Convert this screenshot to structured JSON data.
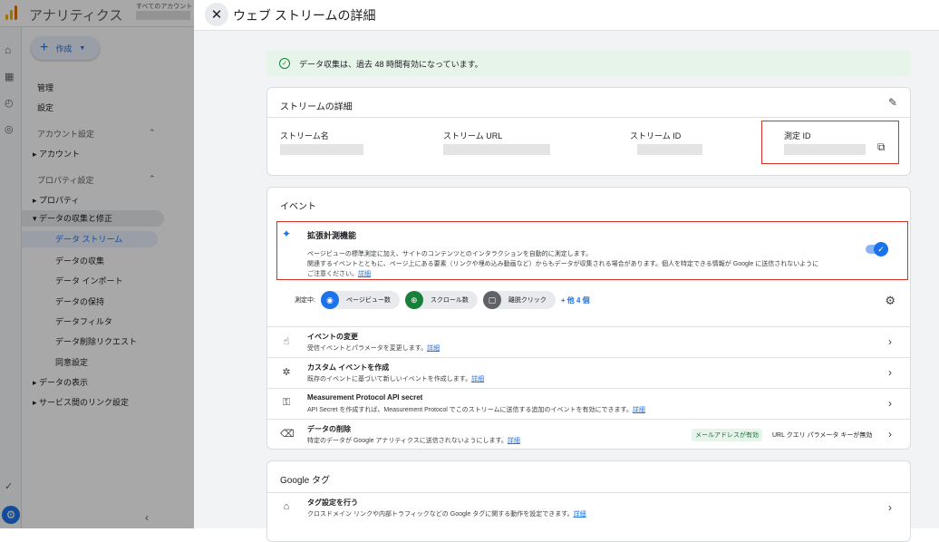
{
  "app": {
    "name": "アナリティクス",
    "account_label": "すべてのアカウント",
    "create_label": "作成"
  },
  "sidebar": {
    "items": [
      {
        "label": "管理",
        "type": "item"
      },
      {
        "label": "設定",
        "type": "item"
      },
      {
        "label": "アカウント設定",
        "type": "header"
      },
      {
        "label": "アカウント",
        "type": "expandable"
      },
      {
        "label": "プロパティ設定",
        "type": "header"
      },
      {
        "label": "プロパティ",
        "type": "expandable"
      },
      {
        "label": "データの収集と修正",
        "type": "expanded"
      },
      {
        "label": "データ ストリーム",
        "type": "selected"
      },
      {
        "label": "データの収集",
        "type": "sub"
      },
      {
        "label": "データ インポート",
        "type": "sub"
      },
      {
        "label": "データの保持",
        "type": "sub"
      },
      {
        "label": "データフィルタ",
        "type": "sub"
      },
      {
        "label": "データ削除リクエスト",
        "type": "sub"
      },
      {
        "label": "同意設定",
        "type": "sub"
      },
      {
        "label": "データの表示",
        "type": "expandable"
      },
      {
        "label": "サービス間のリンク設定",
        "type": "expandable"
      }
    ]
  },
  "drawer": {
    "title": "ウェブ ストリームの詳細",
    "banner": "データ収集は、過去 48 時間有効になっています。",
    "stream_details": {
      "title": "ストリームの詳細",
      "name_label": "ストリーム名",
      "url_label": "ストリーム URL",
      "id_label": "ストリーム ID",
      "measurement_id_label": "測定 ID"
    },
    "events": {
      "title": "イベント",
      "enhanced_title": "拡張計測機能",
      "enhanced_desc_1": "ページビューの標準測定に加え、サイトのコンテンツとのインタラクションを自動的に測定します。",
      "enhanced_desc_2": "関連するイベントとともに、ページ上にある要素（リンクや埋め込み動画など）からもデータが収集される場合があります。個人を特定できる情報が Google に送信されないように",
      "enhanced_desc_3": "ご注意ください。",
      "detail_link": "詳細",
      "measuring_label": "測定中:",
      "chips": [
        "ページビュー数",
        "スクロール数",
        "離脱クリック"
      ],
      "more_label": "+ 他 4 個",
      "rows": [
        {
          "title": "イベントの変更",
          "desc": "受信イベントとパラメータを変更します。",
          "link": "詳細"
        },
        {
          "title": "カスタム イベントを作成",
          "desc": "既存のイベントに基づいて新しいイベントを作成します。",
          "link": "詳細"
        },
        {
          "title": "Measurement Protocol API secret",
          "desc": "API Secret を作成すれば、Measurement Protocol でこのストリームに送信する追加のイベントを有効にできます。",
          "link": "詳細"
        },
        {
          "title": "データの削除",
          "desc": "特定のデータが Google アナリティクスに送信されないようにします。",
          "link": "詳細"
        }
      ],
      "badge_email": "メールアドレスが有効",
      "badge_url": "URL クエリ パラメータ キーが無効"
    },
    "google_tag": {
      "title": "Google タグ",
      "row_title": "タグ設定を行う",
      "row_desc": "クロスドメイン リンクや内部トラフィックなどの Google タグに関する動作を設定できます。",
      "row_link": "詳細"
    }
  }
}
